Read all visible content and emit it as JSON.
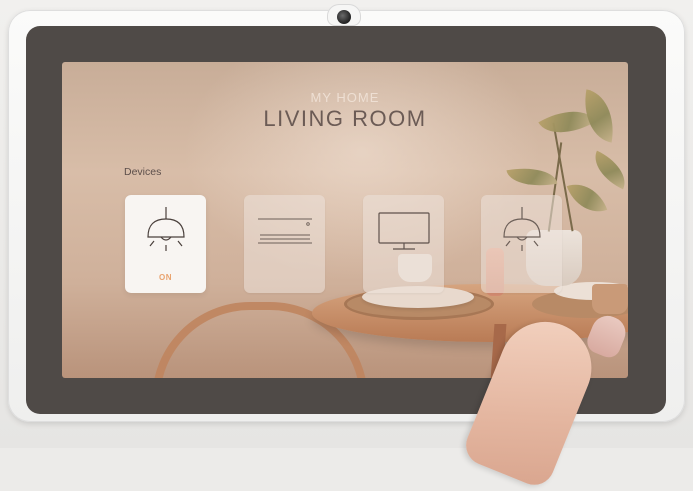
{
  "header": {
    "subtitle": "MY HOME",
    "title": "LIVING ROOM"
  },
  "devices": {
    "label": "Devices",
    "items": [
      {
        "icon": "ceiling-lamp-icon",
        "status": "ON",
        "active": true
      },
      {
        "icon": "air-conditioner-icon",
        "status": "",
        "active": false
      },
      {
        "icon": "tv-icon",
        "status": "",
        "active": false
      },
      {
        "icon": "ceiling-lamp-icon",
        "status": "",
        "active": false
      }
    ]
  },
  "colors": {
    "accent_on": "#e9a36f",
    "title": "#6b5b55",
    "bezel": "#4f4a47"
  }
}
